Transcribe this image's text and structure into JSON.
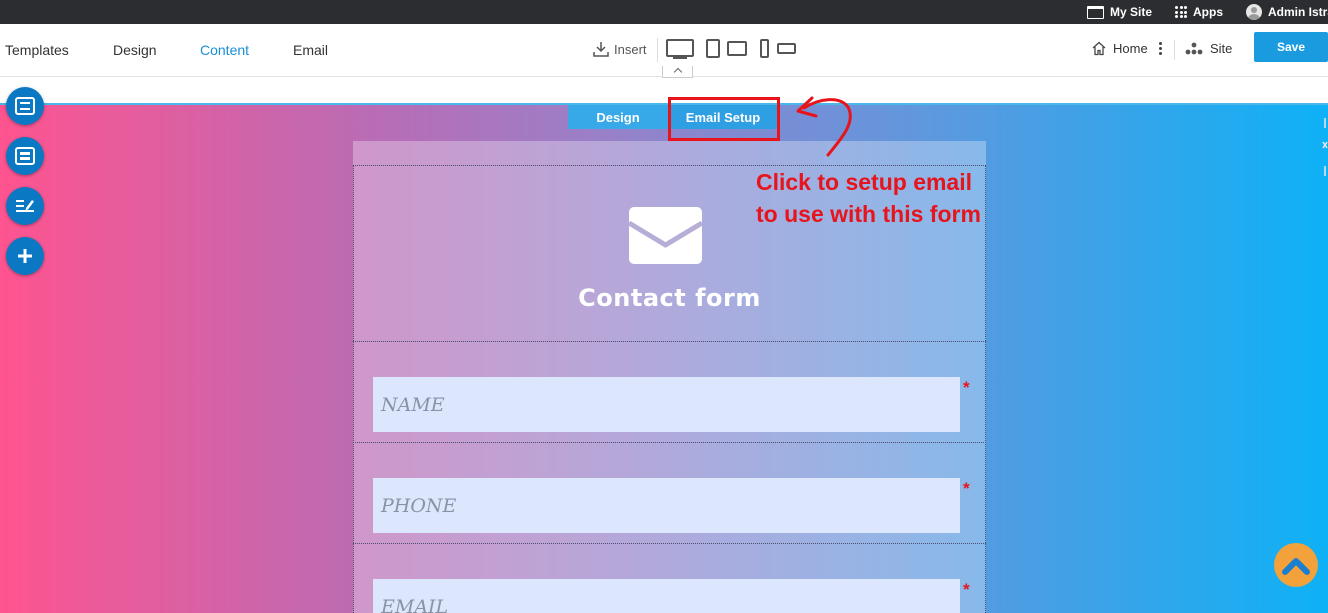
{
  "topbar": {
    "my_site": "My Site",
    "apps": "Apps",
    "admin": "Admin Istra"
  },
  "toolbar": {
    "tabs": [
      "Templates",
      "Design",
      "Content",
      "Email"
    ],
    "active_tab": "Content",
    "insert_label": "Insert",
    "home_label": "Home",
    "site_label": "Site",
    "save_label": "Save"
  },
  "editor": {
    "tabs": {
      "design": "Design",
      "email_setup": "Email Setup"
    }
  },
  "form": {
    "title": "Contact form",
    "fields": [
      {
        "placeholder": "NAME",
        "required_mark": "*"
      },
      {
        "placeholder": "PHONE",
        "required_mark": "*"
      },
      {
        "placeholder": "EMAIL",
        "required_mark": "*"
      }
    ]
  },
  "annotation": {
    "line1": "Click to setup email",
    "line2": "to use with this form"
  },
  "colors": {
    "accent": "#1a9be0",
    "annotation_red": "#e8141c",
    "gradient_left": "#fe5490",
    "gradient_right": "#0eb1f6",
    "scroll_top": "#f3a13a"
  }
}
